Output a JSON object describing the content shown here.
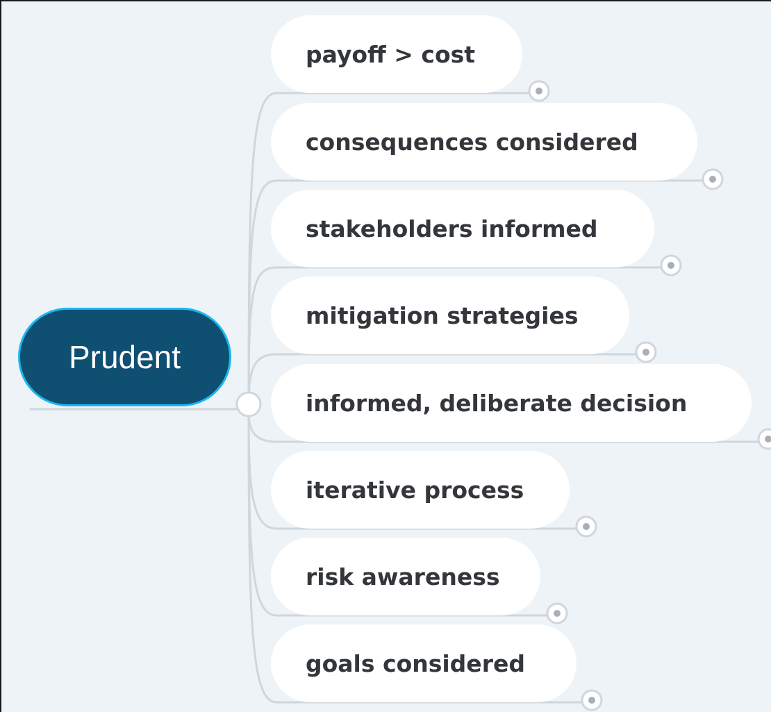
{
  "root": {
    "label": "Prudent"
  },
  "branches": [
    {
      "label": "payoff > cost"
    },
    {
      "label": "consequences considered"
    },
    {
      "label": "stakeholders informed"
    },
    {
      "label": "mitigation strategies"
    },
    {
      "label": "informed, deliberate decision"
    },
    {
      "label": "iterative process"
    },
    {
      "label": "risk awareness"
    },
    {
      "label": "goals considered"
    }
  ],
  "colors": {
    "background": "#eef3f7",
    "root_fill": "#0f4f72",
    "root_border": "#19b6f0",
    "node_fill": "#ffffff",
    "node_text": "#33363a",
    "connector": "#cfd6dc"
  }
}
